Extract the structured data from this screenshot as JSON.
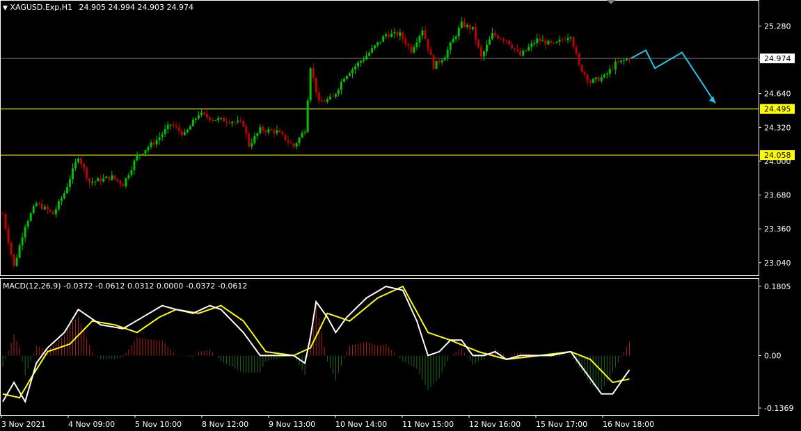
{
  "header": {
    "symbol": "XAGUSD.Exp,H1",
    "ohlc": "24.905 24.994 24.903 24.974"
  },
  "macd_header": "MACD(12,26,9) -0.0372 -0.0612 0.0312 0.0000 -0.0372 -0.0612",
  "colors": {
    "background": "#000000",
    "frame": "#ffffff",
    "bull": "#00c000",
    "bear": "#c00000",
    "level_line": "#ffff00",
    "current_line": "#808080",
    "forecast": "#1ec8e6",
    "macd_main": "#ffffff",
    "macd_signal": "#ffff00"
  },
  "chart_data": [
    {
      "type": "candlestick",
      "title": "XAGUSD.Exp,H1",
      "ylim": [
        22.92,
        25.52
      ],
      "y_ticks": [
        "25.280",
        "24.960",
        "24.640",
        "24.320",
        "24.000",
        "23.680",
        "23.360",
        "23.040"
      ],
      "y_tick_values": [
        25.28,
        24.96,
        24.64,
        24.32,
        24.0,
        23.68,
        23.36,
        23.04
      ],
      "current_price": {
        "label": "24.974",
        "value": 24.974
      },
      "horizontal_levels": [
        {
          "label": "24.495",
          "value": 24.495
        },
        {
          "label": "24.058",
          "value": 24.058
        }
      ],
      "x_labels": [
        "3 Nov 2021",
        "4 Nov 09:00",
        "5 Nov 10:00",
        "8 Nov 12:00",
        "9 Nov 13:00",
        "10 Nov 14:00",
        "11 Nov 15:00",
        "12 Nov 16:00",
        "15 Nov 17:00",
        "16 Nov 18:00"
      ],
      "close_path": [
        {
          "i": 0,
          "v": 23.5
        },
        {
          "i": 4,
          "v": 23.0
        },
        {
          "i": 8,
          "v": 23.4
        },
        {
          "i": 12,
          "v": 23.6
        },
        {
          "i": 18,
          "v": 23.5
        },
        {
          "i": 22,
          "v": 23.7
        },
        {
          "i": 27,
          "v": 24.05
        },
        {
          "i": 31,
          "v": 23.8
        },
        {
          "i": 39,
          "v": 23.85
        },
        {
          "i": 43,
          "v": 23.78
        },
        {
          "i": 48,
          "v": 24.05
        },
        {
          "i": 55,
          "v": 24.2
        },
        {
          "i": 60,
          "v": 24.35
        },
        {
          "i": 65,
          "v": 24.25
        },
        {
          "i": 70,
          "v": 24.45
        },
        {
          "i": 75,
          "v": 24.4
        },
        {
          "i": 82,
          "v": 24.38
        },
        {
          "i": 86,
          "v": 24.35
        },
        {
          "i": 88,
          "v": 24.15
        },
        {
          "i": 92,
          "v": 24.3
        },
        {
          "i": 98,
          "v": 24.28
        },
        {
          "i": 104,
          "v": 24.14
        },
        {
          "i": 108,
          "v": 24.3
        },
        {
          "i": 110,
          "v": 24.9
        },
        {
          "i": 113,
          "v": 24.55
        },
        {
          "i": 118,
          "v": 24.6
        },
        {
          "i": 122,
          "v": 24.8
        },
        {
          "i": 130,
          "v": 25.0
        },
        {
          "i": 137,
          "v": 25.2
        },
        {
          "i": 142,
          "v": 25.2
        },
        {
          "i": 146,
          "v": 25.05
        },
        {
          "i": 150,
          "v": 25.25
        },
        {
          "i": 154,
          "v": 24.9
        },
        {
          "i": 158,
          "v": 25.0
        },
        {
          "i": 164,
          "v": 25.3
        },
        {
          "i": 168,
          "v": 25.25
        },
        {
          "i": 171,
          "v": 24.98
        },
        {
          "i": 175,
          "v": 25.2
        },
        {
          "i": 180,
          "v": 25.15
        },
        {
          "i": 185,
          "v": 25.0
        },
        {
          "i": 191,
          "v": 25.15
        },
        {
          "i": 197,
          "v": 25.1
        },
        {
          "i": 203,
          "v": 25.2
        },
        {
          "i": 206,
          "v": 24.9
        },
        {
          "i": 210,
          "v": 24.75
        },
        {
          "i": 215,
          "v": 24.8
        },
        {
          "i": 219,
          "v": 24.92
        },
        {
          "i": 224,
          "v": 24.974
        }
      ],
      "forecast_path": [
        24.974,
        25.05,
        24.88,
        25.03,
        24.55
      ]
    },
    {
      "type": "line",
      "title": "MACD(12,26,9)",
      "ylim": [
        -0.155,
        0.2
      ],
      "y_ticks": [
        "0.1805",
        "0.00",
        "-0.1369"
      ],
      "y_tick_values": [
        0.1805,
        0.0,
        -0.1369
      ],
      "series": [
        {
          "name": "MACD",
          "values": [
            {
              "i": 0,
              "v": -0.12
            },
            {
              "i": 4,
              "v": -0.07
            },
            {
              "i": 8,
              "v": -0.12
            },
            {
              "i": 12,
              "v": -0.02
            },
            {
              "i": 16,
              "v": 0.02
            },
            {
              "i": 22,
              "v": 0.06
            },
            {
              "i": 27,
              "v": 0.12
            },
            {
              "i": 31,
              "v": 0.1
            },
            {
              "i": 35,
              "v": 0.08
            },
            {
              "i": 43,
              "v": 0.07
            },
            {
              "i": 50,
              "v": 0.1
            },
            {
              "i": 57,
              "v": 0.13
            },
            {
              "i": 62,
              "v": 0.12
            },
            {
              "i": 68,
              "v": 0.11
            },
            {
              "i": 74,
              "v": 0.13
            },
            {
              "i": 78,
              "v": 0.12
            },
            {
              "i": 86,
              "v": 0.06
            },
            {
              "i": 92,
              "v": 0.0
            },
            {
              "i": 98,
              "v": 0.0
            },
            {
              "i": 104,
              "v": 0.0
            },
            {
              "i": 108,
              "v": -0.02
            },
            {
              "i": 110,
              "v": 0.05
            },
            {
              "i": 112,
              "v": 0.14
            },
            {
              "i": 116,
              "v": 0.1
            },
            {
              "i": 119,
              "v": 0.06
            },
            {
              "i": 123,
              "v": 0.1
            },
            {
              "i": 130,
              "v": 0.15
            },
            {
              "i": 137,
              "v": 0.18
            },
            {
              "i": 143,
              "v": 0.17
            },
            {
              "i": 148,
              "v": 0.09
            },
            {
              "i": 152,
              "v": 0.0
            },
            {
              "i": 156,
              "v": 0.01
            },
            {
              "i": 160,
              "v": 0.04
            },
            {
              "i": 164,
              "v": 0.04
            },
            {
              "i": 168,
              "v": 0.0
            },
            {
              "i": 172,
              "v": 0.0
            },
            {
              "i": 176,
              "v": 0.01
            },
            {
              "i": 180,
              "v": -0.01
            },
            {
              "i": 185,
              "v": 0.0
            },
            {
              "i": 190,
              "v": 0.0
            },
            {
              "i": 196,
              "v": 0.0
            },
            {
              "i": 203,
              "v": 0.01
            },
            {
              "i": 210,
              "v": -0.06
            },
            {
              "i": 214,
              "v": -0.1
            },
            {
              "i": 218,
              "v": -0.1
            },
            {
              "i": 224,
              "v": -0.0372
            }
          ]
        },
        {
          "name": "Signal",
          "values": [
            {
              "i": 0,
              "v": -0.1
            },
            {
              "i": 6,
              "v": -0.11
            },
            {
              "i": 10,
              "v": -0.06
            },
            {
              "i": 16,
              "v": 0.01
            },
            {
              "i": 24,
              "v": 0.03
            },
            {
              "i": 32,
              "v": 0.09
            },
            {
              "i": 40,
              "v": 0.08
            },
            {
              "i": 48,
              "v": 0.06
            },
            {
              "i": 56,
              "v": 0.1
            },
            {
              "i": 62,
              "v": 0.12
            },
            {
              "i": 70,
              "v": 0.11
            },
            {
              "i": 78,
              "v": 0.13
            },
            {
              "i": 86,
              "v": 0.09
            },
            {
              "i": 94,
              "v": 0.01
            },
            {
              "i": 104,
              "v": 0.0
            },
            {
              "i": 110,
              "v": 0.02
            },
            {
              "i": 116,
              "v": 0.11
            },
            {
              "i": 124,
              "v": 0.09
            },
            {
              "i": 134,
              "v": 0.15
            },
            {
              "i": 143,
              "v": 0.18
            },
            {
              "i": 152,
              "v": 0.06
            },
            {
              "i": 160,
              "v": 0.04
            },
            {
              "i": 170,
              "v": 0.01
            },
            {
              "i": 180,
              "v": -0.01
            },
            {
              "i": 192,
              "v": 0.0
            },
            {
              "i": 203,
              "v": 0.01
            },
            {
              "i": 210,
              "v": -0.01
            },
            {
              "i": 218,
              "v": -0.07
            },
            {
              "i": 224,
              "v": -0.0612
            }
          ]
        }
      ]
    }
  ]
}
